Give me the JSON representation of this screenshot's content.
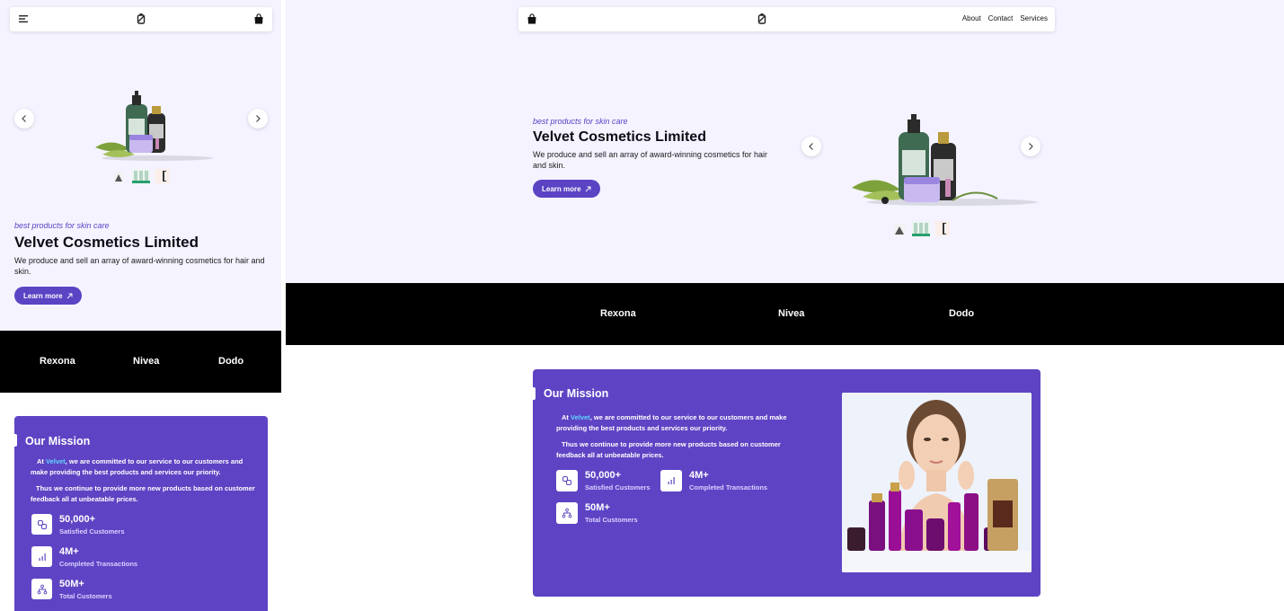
{
  "hero": {
    "tagline": "best products for skin care",
    "title": "Velvet Cosmetics Limited",
    "description": "We produce and sell an array of award-winning cosmetics for hair and skin.",
    "cta": "Learn more"
  },
  "nav": {
    "links": [
      "About",
      "Contact",
      "Services"
    ]
  },
  "brands": [
    "Rexona",
    "Nivea",
    "Dodo"
  ],
  "mission": {
    "title": "Our Mission",
    "p1_prefix": "At ",
    "p1_highlight": "Velvet",
    "p1_suffix": ", we are committed to our service to our customers and make providing the best products and services our priority.",
    "p2": "Thus we continue to provide more new products based on customer feedback all at unbeatable prices.",
    "stats": [
      {
        "value": "50,000+",
        "label": "Satisfied Customers",
        "icon": "link-icon"
      },
      {
        "value": "4M+",
        "label": "Completed Transactions",
        "icon": "bar-chart-icon"
      },
      {
        "value": "50M+",
        "label": "Total Customers",
        "icon": "hierarchy-icon"
      }
    ]
  },
  "colors": {
    "accent": "#5e44c4",
    "hero_bg": "#f4f3ff",
    "brands_bg": "#000000",
    "highlight": "#5fd6ff"
  }
}
